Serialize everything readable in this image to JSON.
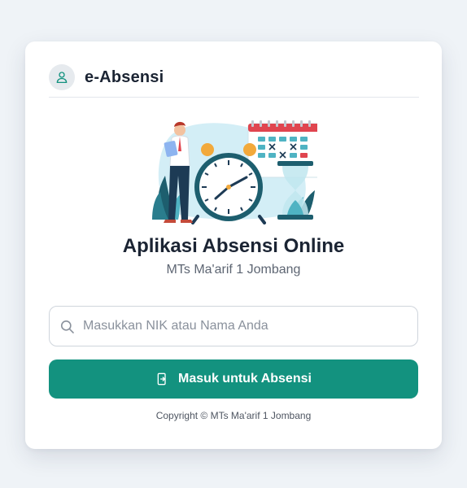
{
  "header": {
    "brand": "e-Absensi",
    "avatar_icon": "user-icon"
  },
  "hero": {
    "illustration": "attendance-clock-calendar-illustration",
    "title": "Aplikasi Absensi Online",
    "subtitle": "MTs Ma'arif 1 Jombang"
  },
  "search": {
    "icon": "search-icon",
    "placeholder": "Masukkan NIK atau Nama Anda",
    "value": ""
  },
  "login_button": {
    "icon": "phone-login-icon",
    "label": "Masuk untuk Absensi"
  },
  "footer": {
    "copyright": "Copyright © MTs Ma'arif 1 Jombang"
  },
  "colors": {
    "accent": "#13927f",
    "background": "#eff3f7",
    "text": "#1b2433"
  }
}
